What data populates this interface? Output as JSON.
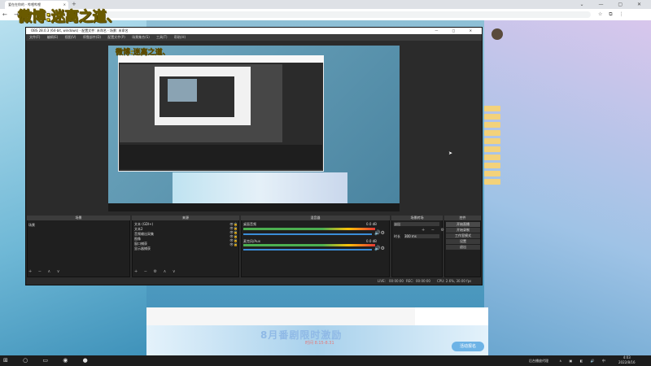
{
  "browser": {
    "tab_title": "爱在在你的 - 哔哩哔哩",
    "tab_close": "×",
    "new_tab": "+",
    "window_controls": "⌄ — ▢ ✕",
    "nav": "← → ⟳"
  },
  "watermark": {
    "text": "微博:迷离之道、",
    "preview_text": "微博:迷离之道、"
  },
  "obs": {
    "title": "OBS 28.0.3 (64-bit, windows) - 配置文件: 未命名 - 场景: 未命名",
    "title_controls": "— ▢ ✕",
    "menu": [
      "文件(F)",
      "编辑(E)",
      "视图(V)",
      "停靠部件(D)",
      "配置文件(P)",
      "场景集合(S)",
      "工具(T)",
      "帮助(H)"
    ],
    "docks": {
      "scenes": {
        "header": "场景",
        "items": [
          "场景"
        ],
        "toolbar": "+ − ∧ ∨"
      },
      "sources": {
        "header": "来源",
        "items": [
          "文本 (GDI+)",
          "文本2",
          "音频输出采集",
          "图像",
          "窗口捕获",
          "显示器捕获"
        ],
        "toolbar": "+ − ⚙ ∧ ∨"
      },
      "mixer": {
        "header": "混音器",
        "tracks": [
          {
            "name": "桌面音频",
            "db": "0.0 dB"
          },
          {
            "name": "麦克风/Aux",
            "db": "0.0 dB"
          }
        ]
      },
      "transitions": {
        "header": "场景转场",
        "type": "淡出",
        "duration_label": "时长",
        "duration_value": "300 ms"
      },
      "controls": {
        "header": "控件",
        "buttons": [
          "开始直播",
          "开始录制",
          "工作室模式",
          "设置",
          "退出"
        ]
      }
    },
    "status": {
      "live_label": "LIVE:",
      "live_time": "00:00:00",
      "rec_label": "REC:",
      "rec_time": "00:00:00",
      "cpu": "CPU: 2.6%, 30.00 fps"
    }
  },
  "page": {
    "banner_text": "8月番剧限时激励",
    "banner_sub": "时间 8.15-8.31",
    "banner_button": "活动报名"
  },
  "taskbar": {
    "tray_text": "后台播放代理",
    "clock_time": "4:03",
    "clock_date": "2022/8/16"
  },
  "colors": {
    "obs_bg": "#2b2b2b",
    "obs_dock": "#1f1f1f",
    "watermark": "#ffe93d",
    "meter_green": "#4caf50",
    "slider_blue": "#3b8dd8"
  }
}
